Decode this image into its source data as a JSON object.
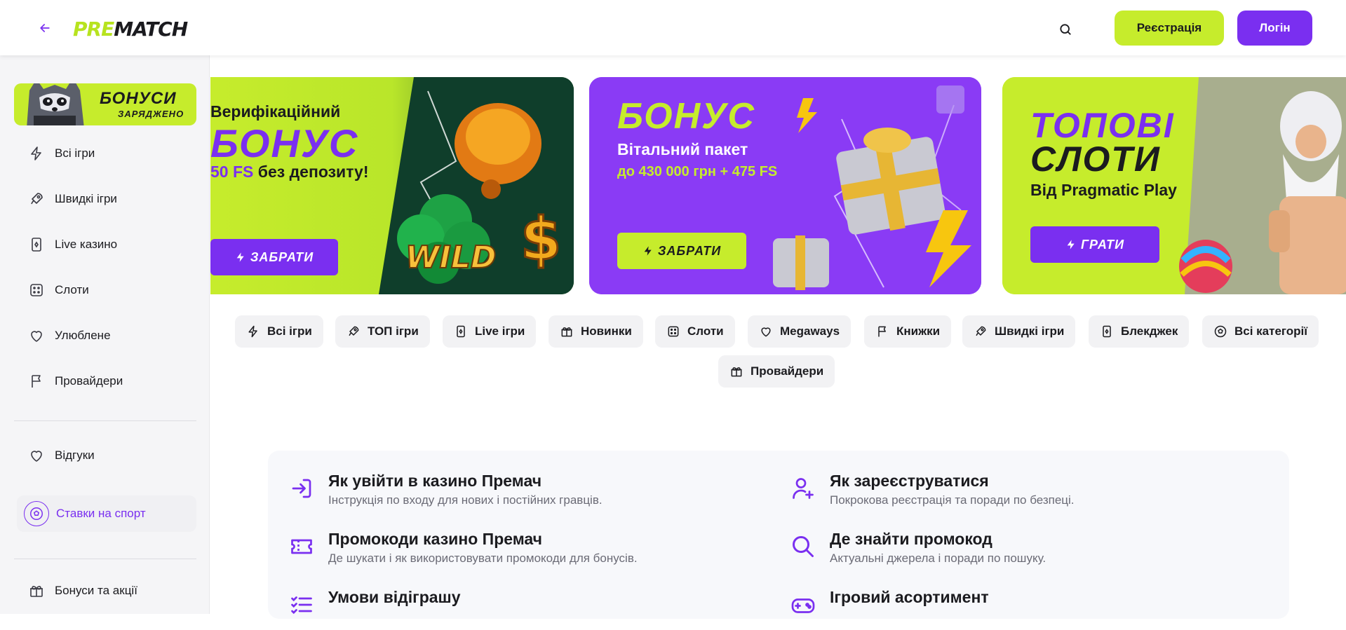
{
  "header": {
    "logo_pre": "PRE",
    "logo_match": "MATCH",
    "register_label": "Реєстрація",
    "login_label": "Логін"
  },
  "colors": {
    "accent": "#7a2ff0",
    "lime": "#c6ec2c"
  },
  "sidebar": {
    "promo_title": "БОНУСИ",
    "promo_subtitle": "ЗАРЯДЖЕНО",
    "items": [
      {
        "label": "Всі ігри",
        "icon": "lightning-icon"
      },
      {
        "label": "Швидкі ігри",
        "icon": "rocket-icon"
      },
      {
        "label": "Live казино",
        "icon": "card-icon"
      },
      {
        "label": "Слоти",
        "icon": "dice-icon"
      },
      {
        "label": "Улюблене",
        "icon": "heart-icon"
      },
      {
        "label": "Провайдери",
        "icon": "flag-icon"
      }
    ],
    "reviews_label": "Відгуки",
    "sport_label": "Ставки на спорт",
    "bonuses_label": "Бонуси та акції"
  },
  "banners": [
    {
      "line1": "Верифікаційний",
      "big": "БОНУС",
      "fs": "50 FS",
      "line3": "без депозиту!",
      "art": "WILD",
      "button": "ЗАБРАТИ"
    },
    {
      "big": "БОНУС",
      "line1": "Вітальний пакет",
      "line2": "до 430 000 грн + 475 FS",
      "button": "ЗАБРАТИ"
    },
    {
      "big1": "ТОПОВІ",
      "big2": "СЛОТИ",
      "line1": "Від Pragmatic Play",
      "button": "ГРАТИ"
    }
  ],
  "categories": [
    {
      "label": "Всі ігри",
      "icon": "lightning-icon"
    },
    {
      "label": "ТОП ігри",
      "icon": "rocket-icon"
    },
    {
      "label": "Live ігри",
      "icon": "card-icon"
    },
    {
      "label": "Новинки",
      "icon": "gift-icon"
    },
    {
      "label": "Слоти",
      "icon": "dice-icon"
    },
    {
      "label": "Megaways",
      "icon": "heart-icon"
    },
    {
      "label": "Книжки",
      "icon": "flag-icon"
    },
    {
      "label": "Швидкі ігри",
      "icon": "rocket-icon"
    },
    {
      "label": "Блекджек",
      "icon": "card-icon"
    },
    {
      "label": "Всі категорії",
      "icon": "ball-icon"
    },
    {
      "label": "Провайдери",
      "icon": "gift-icon"
    }
  ],
  "info": [
    {
      "title": "Як увійти в казино Премач",
      "desc": "Інструкція по входу для нових і постійних гравців.",
      "icon": "login-icon"
    },
    {
      "title": "Як зареєструватися",
      "desc": "Покрокова реєстрація та поради по безпеці.",
      "icon": "user-plus-icon"
    },
    {
      "title": "Промокоди казино Премач",
      "desc": "Де шукати і як використовувати промокоди для бонусів.",
      "icon": "ticket-icon"
    },
    {
      "title": "Де знайти промокод",
      "desc": "Актуальні джерела і поради по пошуку.",
      "icon": "search-icon"
    },
    {
      "title": "Умови відіграшу",
      "desc": "",
      "icon": "list-icon"
    },
    {
      "title": "Ігровий асортимент",
      "desc": "",
      "icon": "gamepad-icon"
    }
  ]
}
